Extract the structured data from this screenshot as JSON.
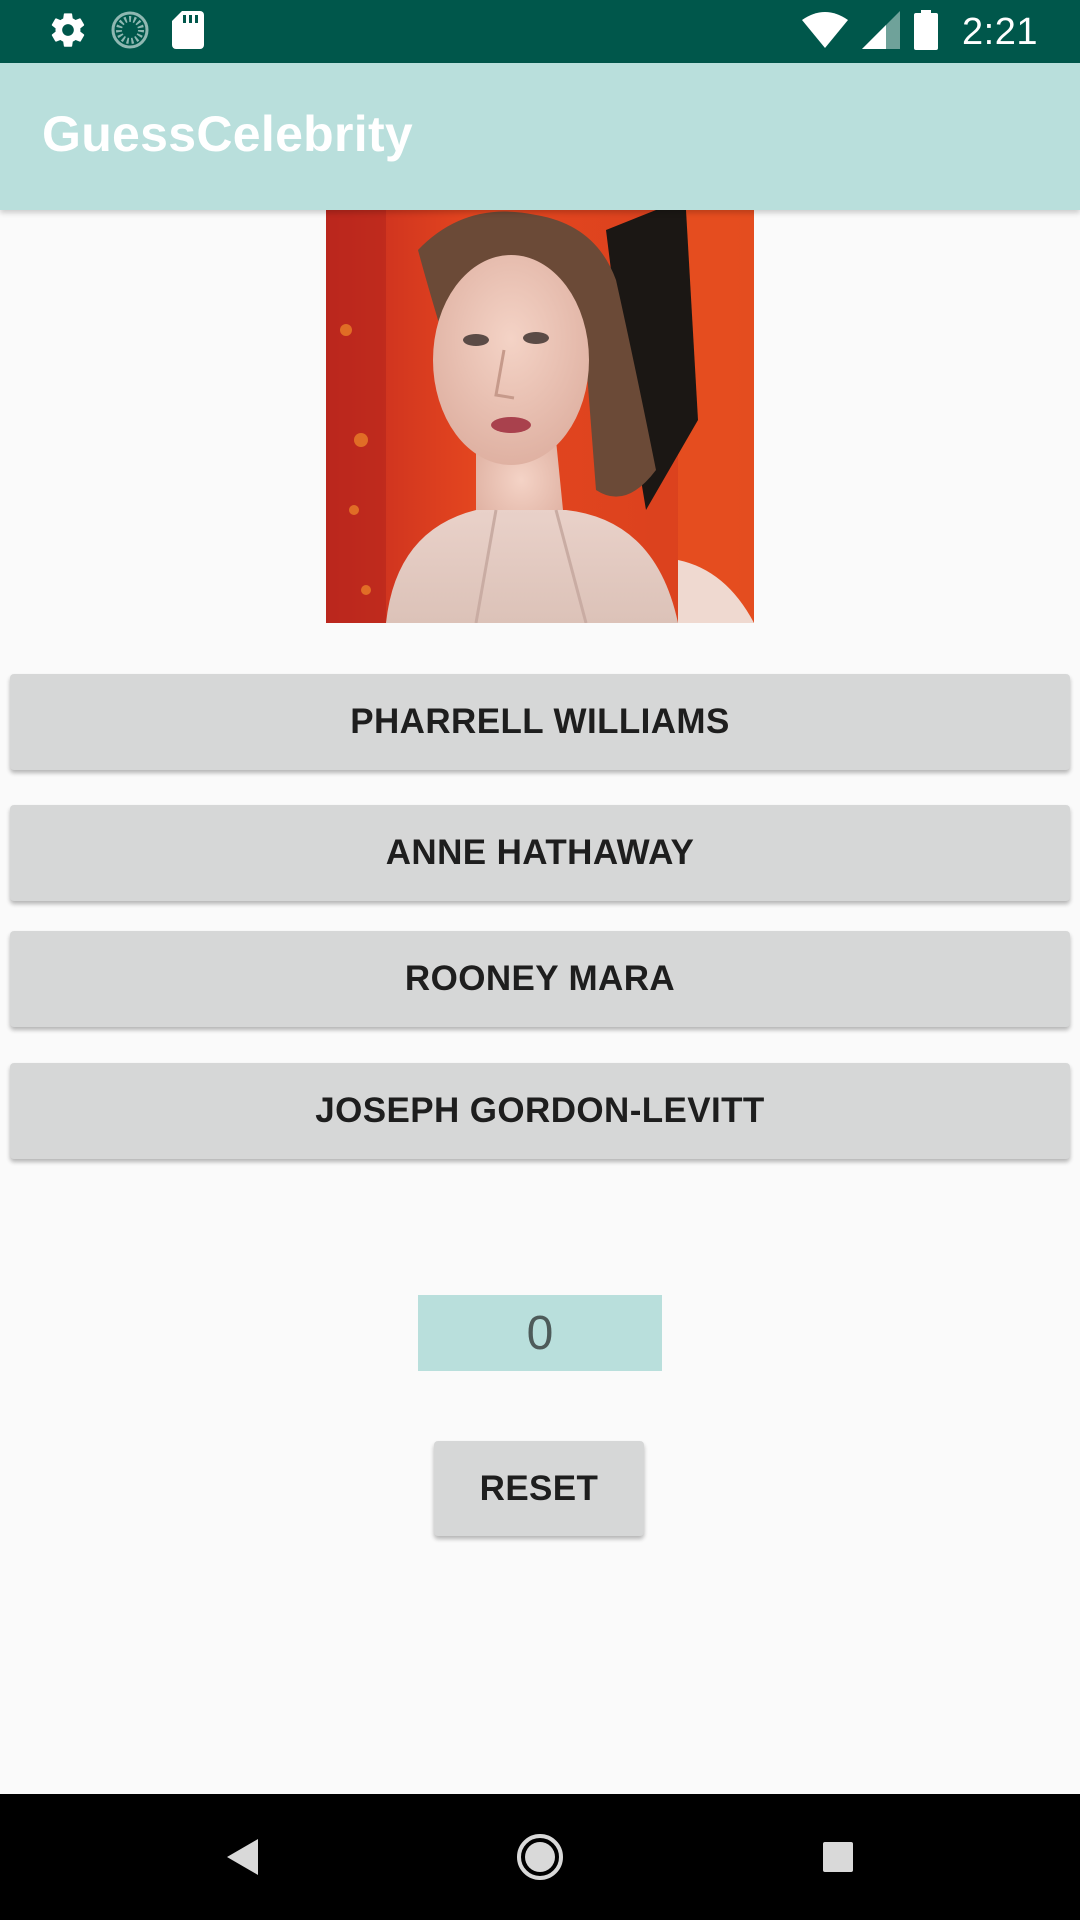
{
  "status_bar": {
    "time": "2:21",
    "left_icons": [
      "settings-gear-icon",
      "sync-progress-icon",
      "sd-card-icon"
    ],
    "right_icons": [
      "wifi-icon",
      "cell-signal-icon",
      "battery-icon"
    ]
  },
  "app_bar": {
    "title": "GuessCelebrity"
  },
  "question": {
    "image": "celebrity-photo"
  },
  "answers": [
    {
      "label": "PHARRELL WILLIAMS"
    },
    {
      "label": "ANNE HATHAWAY"
    },
    {
      "label": "ROONEY MARA"
    },
    {
      "label": "JOSEPH GORDON-LEVITT"
    }
  ],
  "score": {
    "value": "0"
  },
  "reset": {
    "label": "RESET"
  },
  "nav_bar": {
    "buttons": [
      "back-icon",
      "home-icon",
      "recents-icon"
    ]
  },
  "colors": {
    "status_bar": "#00574b",
    "app_bar": "#b9dfdc",
    "button": "#d6d7d7",
    "background": "#fafafa"
  }
}
